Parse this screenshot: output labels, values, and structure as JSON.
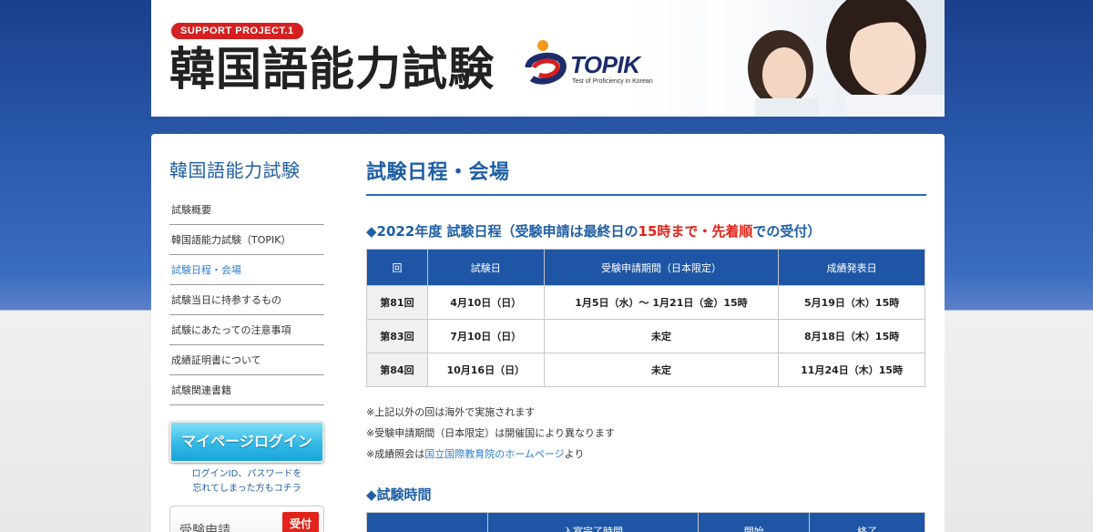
{
  "header": {
    "badge": "SUPPORT PROJECT.1",
    "title": "韓国語能力試験",
    "logo_text": "TOPIK",
    "logo_sub": "Test of Proficiency in Korean"
  },
  "sidebar": {
    "title": "韓国語能力試験",
    "items": [
      {
        "label": "試験概要"
      },
      {
        "label": "韓国語能力試験（TOPIK）"
      },
      {
        "label": "試験日程・会場"
      },
      {
        "label": "試験当日に持参するもの"
      },
      {
        "label": "試験にあたっての注意事項"
      },
      {
        "label": "成績証明書について"
      },
      {
        "label": "試験関連書籍"
      }
    ],
    "login_button": "マイページログイン",
    "login_note_1": "ログインID、パスワードを",
    "login_note_2": "忘れてしまった方もコチラ",
    "apply_label": "受験申請",
    "apply_tag": "受付"
  },
  "content": {
    "page_title": "試験日程・会場",
    "schedule": {
      "title_pre": "◆2022年度 試験日程（受験申請は最終日の",
      "title_red1": "15時まで",
      "title_mid": "・",
      "title_red2": "先着順",
      "title_post": "での受付）",
      "headers": [
        "回",
        "試験日",
        "受験申請期間（日本限定）",
        "成績発表日"
      ],
      "rows": [
        [
          "第81回",
          "4月10日（日）",
          "1月5日（水）～ 1月21日（金）15時",
          "5月19日（木）15時"
        ],
        [
          "第83回",
          "7月10日（日）",
          "未定",
          "8月18日（木）15時"
        ],
        [
          "第84回",
          "10月16日（日）",
          "未定",
          "11月24日（木）15時"
        ]
      ]
    },
    "notes": {
      "n1": "※上記以外の回は海外で実施されます",
      "n2": "※受験申請期間（日本限定）は開催国により異なります",
      "n3_pre": "※成績照会は",
      "n3_link": "国立国際教育院のホームページ",
      "n3_post": "より"
    },
    "exam_time": {
      "title": "◆試験時間",
      "headers": [
        "",
        "入室完了時間",
        "開始",
        "終了"
      ]
    }
  }
}
